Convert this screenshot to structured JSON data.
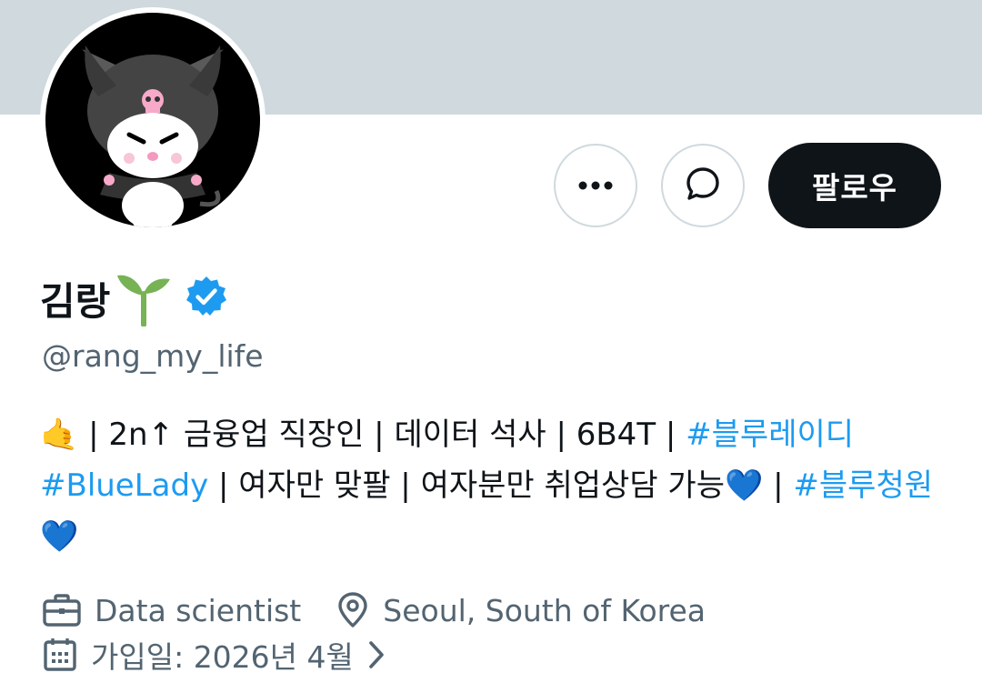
{
  "profile": {
    "display_name": "김랑",
    "handle": "@rang_my_life",
    "follow_label": "팔로우",
    "bio": {
      "emoji_call_me": "🤙",
      "part1": " | 2n↑ 금융업 직장인 | 데이터 석사 | 6B4T | ",
      "tag1": "#블루레이디",
      "space1": " ",
      "tag2": "#BlueLady",
      "part2": " | 여자만 맞팔 | 여자분만 취업상담 가능",
      "heart1": "💙",
      "part3": " | ",
      "tag3": "#블루청원",
      "heart2": "💙"
    },
    "meta": {
      "job": "Data scientist",
      "location": "Seoul, South of Korea",
      "joined": "가입일: 2026년 4월"
    }
  },
  "colors": {
    "banner": "#cfd9de",
    "link": "#1d9bf0",
    "verified": "#1d9bf0",
    "secondary_text": "#536471",
    "follow_button": "#0f1419"
  },
  "icons": {
    "more": "more-horizontal-icon",
    "message": "message-bubble-icon",
    "verified": "verified-badge-icon",
    "sprout": "sprout-icon",
    "job": "briefcase-icon",
    "location": "location-pin-icon",
    "joined": "calendar-icon",
    "chevron": "chevron-right-icon"
  }
}
